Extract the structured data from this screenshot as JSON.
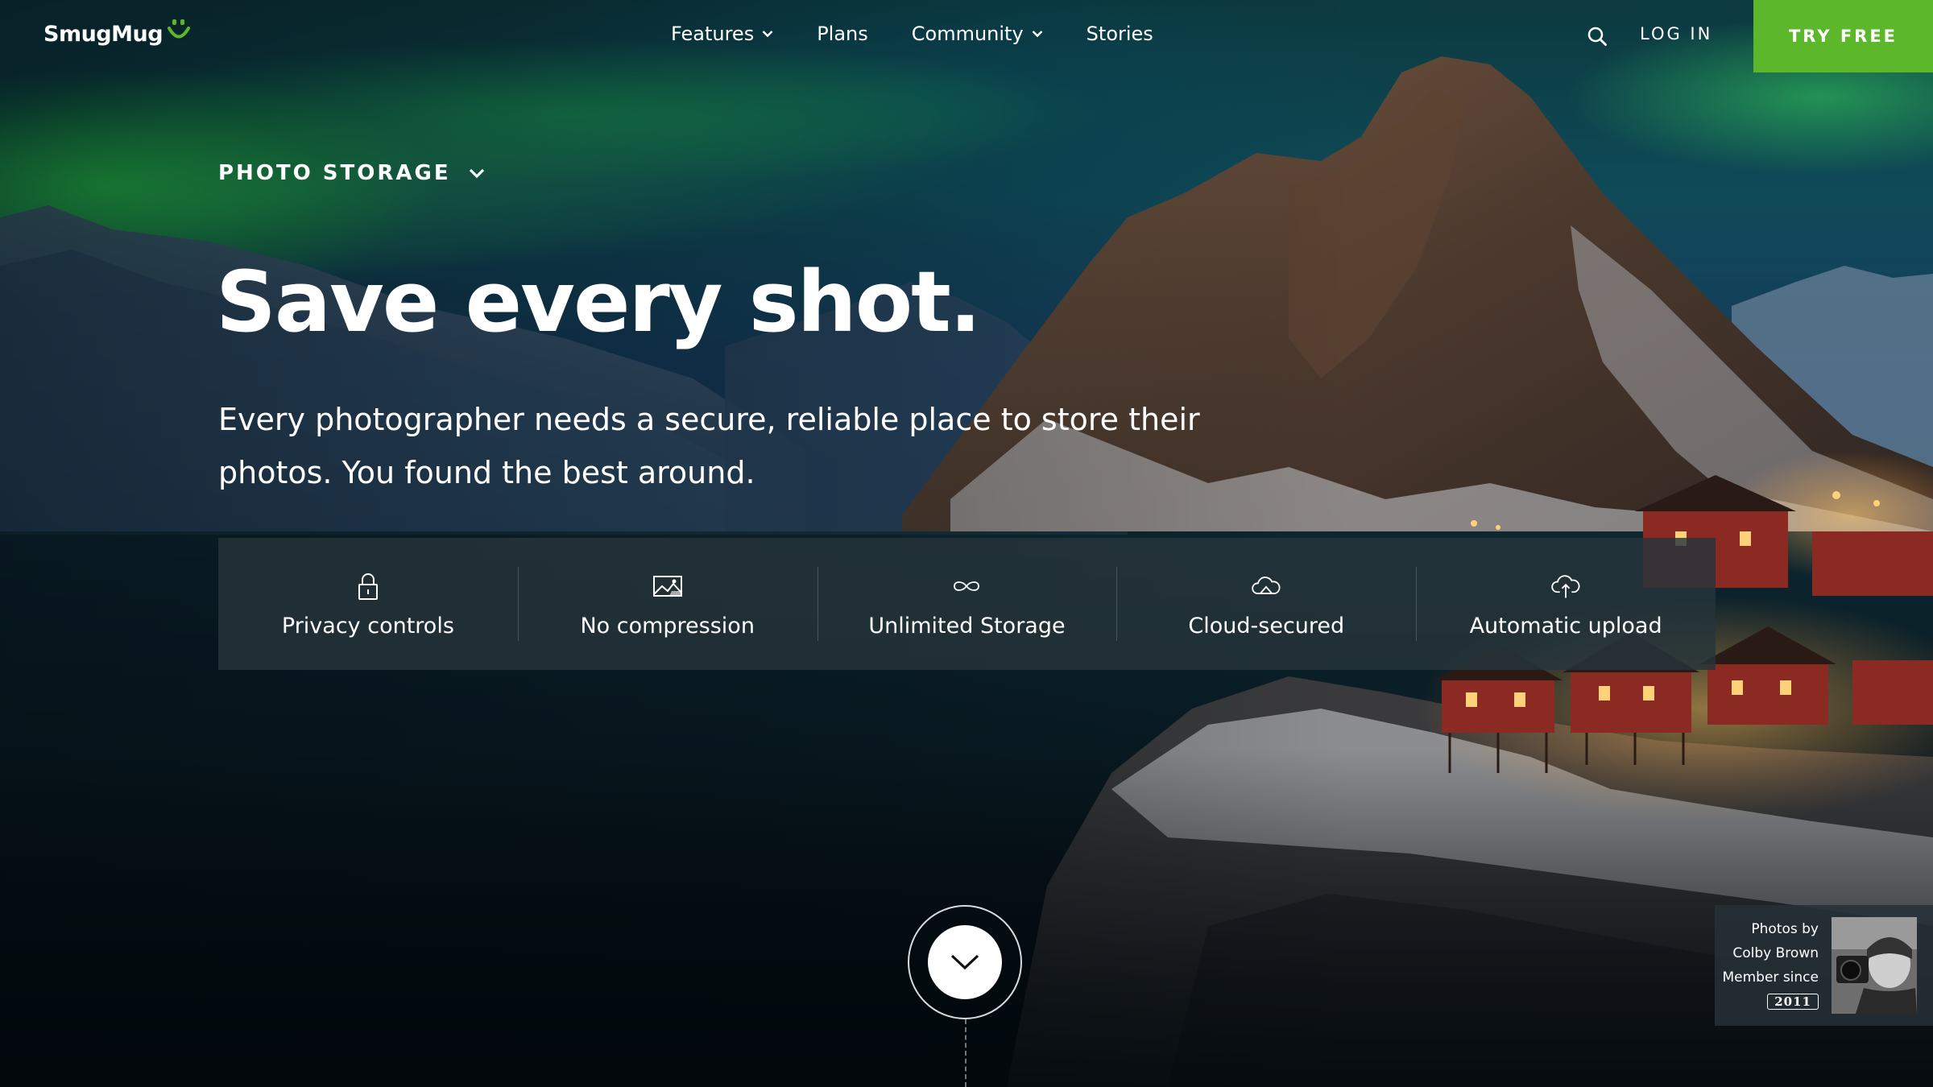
{
  "colors": {
    "accent": "#5cb82a",
    "aurora": "#35e05a",
    "feature_bar": "#26343a"
  },
  "header": {
    "logo_text": "SmugMug",
    "logo_icon": "smug-face-icon",
    "nav": [
      {
        "label": "Features",
        "has_dropdown": true
      },
      {
        "label": "Plans",
        "has_dropdown": false
      },
      {
        "label": "Community",
        "has_dropdown": true
      },
      {
        "label": "Stories",
        "has_dropdown": false
      }
    ],
    "search_icon": "search-icon",
    "login_label": "LOG IN",
    "cta_label": "TRY FREE"
  },
  "hero": {
    "category": "PHOTO STORAGE",
    "headline": "Save every shot.",
    "subheadline": "Every photographer needs a secure, reliable place to store their photos. You found the best around."
  },
  "features": [
    {
      "icon": "lock-icon",
      "label": "Privacy controls"
    },
    {
      "icon": "image-icon",
      "label": "No compression"
    },
    {
      "icon": "infinity-icon",
      "label": "Unlimited Storage"
    },
    {
      "icon": "cloud-icon",
      "label": "Cloud-secured"
    },
    {
      "icon": "cloud-upload-icon",
      "label": "Automatic upload"
    }
  ],
  "scroll_icon": "chevron-down-icon",
  "credit": {
    "line1": "Photos by",
    "photographer": "Colby Brown",
    "line3": "Member since",
    "year": "2011"
  }
}
